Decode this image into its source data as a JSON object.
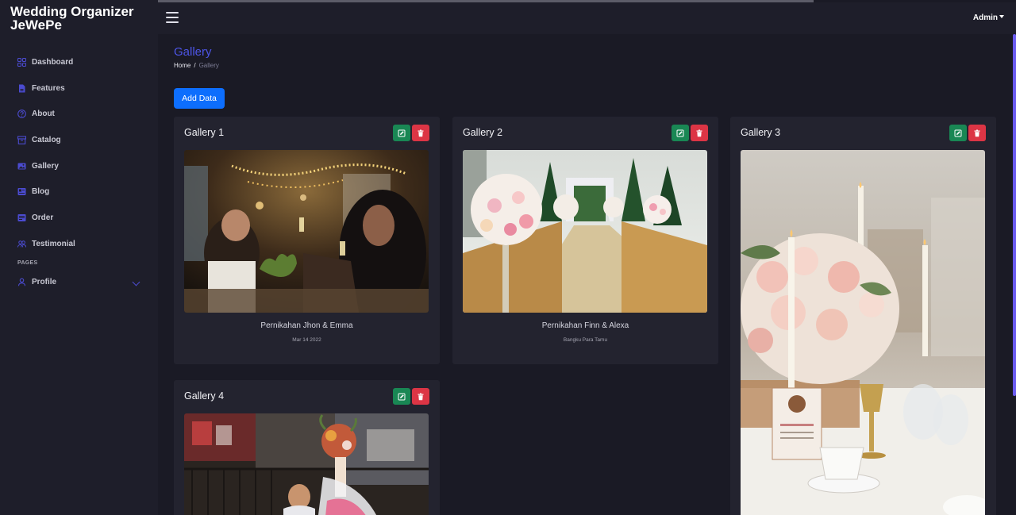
{
  "app": {
    "brand": "Wedding Organizer JeWePe"
  },
  "topbar": {
    "user": "Admin"
  },
  "sidebar": {
    "items": [
      {
        "label": "Dashboard",
        "icon": "grid-icon"
      },
      {
        "label": "Features",
        "icon": "document-icon"
      },
      {
        "label": "About",
        "icon": "question-circle-icon"
      },
      {
        "label": "Catalog",
        "icon": "archive-icon"
      },
      {
        "label": "Gallery",
        "icon": "image-icon"
      },
      {
        "label": "Blog",
        "icon": "newspaper-icon"
      },
      {
        "label": "Order",
        "icon": "receipt-icon"
      },
      {
        "label": "Testimonial",
        "icon": "people-icon"
      }
    ],
    "section_heading": "PAGES",
    "profile": {
      "label": "Profile",
      "icon": "person-icon"
    }
  },
  "page": {
    "title": "Gallery",
    "breadcrumb": {
      "home": "Home",
      "separator": "/",
      "current": "Gallery"
    },
    "add_button": "Add Data"
  },
  "gallery": [
    {
      "title": "Gallery 1",
      "caption": "Pernikahan Jhon & Emma",
      "subcaption": "Mar 14 2022"
    },
    {
      "title": "Gallery 2",
      "caption": "Pernikahan Finn & Alexa",
      "subcaption": "Bangku Para Tamu"
    },
    {
      "title": "Gallery 3",
      "caption": "",
      "subcaption": ""
    },
    {
      "title": "Gallery 4",
      "caption": "",
      "subcaption": ""
    }
  ],
  "colors": {
    "accent": "#4d55e6",
    "primary_button": "#0d6efd",
    "edit_button": "#198754",
    "delete_button": "#dc3545",
    "background": "#1a1a25",
    "panel": "#23232f"
  }
}
